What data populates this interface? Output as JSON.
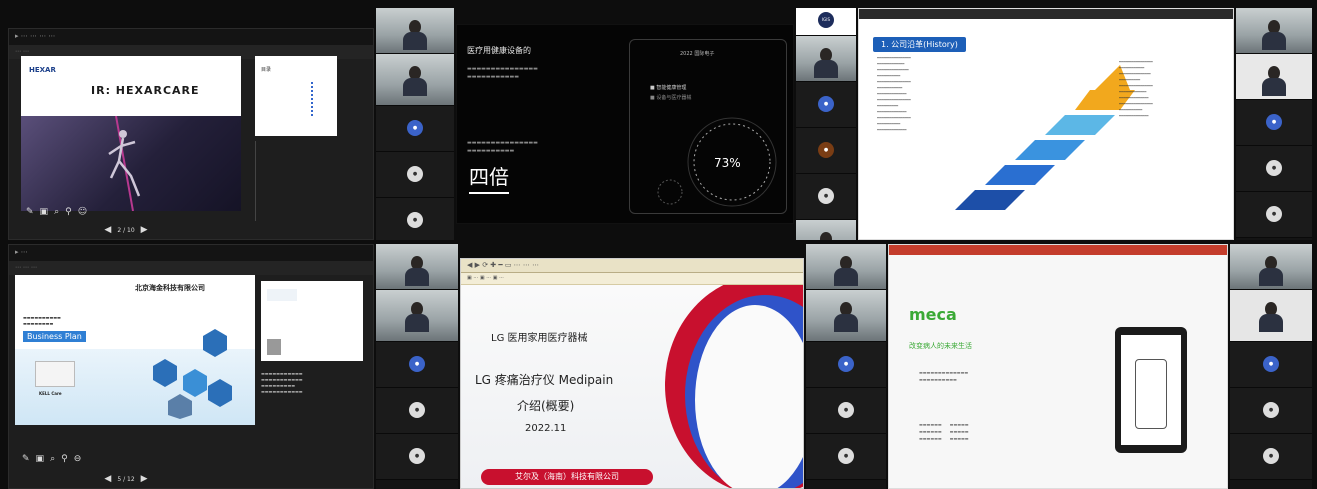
{
  "windows": {
    "hexar": {
      "title": "IR: HEXARCARE",
      "logo": "HEXAR",
      "thumb_title": "目录",
      "page_counter": "2 / 10"
    },
    "dark_slide": {
      "heading": "医疗用健康设备的",
      "big_text": "四倍",
      "percent": "73%",
      "right_title": "2022 国际电子",
      "legend_a": "智能健康管理",
      "legend_b": "设备与医疗器械"
    },
    "history": {
      "title": "1. 公司沿革(History)",
      "brand": "IGIS"
    },
    "beijing": {
      "company": "北京海金科技有限公司",
      "business_plan": "Business Plan",
      "product_name": "KELL Care",
      "page_counter": "5 / 12"
    },
    "lg": {
      "line1": "LG 医用家用医疗器械",
      "line2": "LG 疼痛治疗仪 Medipain",
      "line3": "介绍(概要)",
      "date": "2022.11",
      "footer_company": "艾尔及（海南）科技有限公司"
    },
    "meca": {
      "logo": "meca",
      "slogan": "改变病人的未来生活"
    }
  },
  "colors": {
    "history_blue": "#1d5fb8",
    "lg_red": "#c8102e",
    "avatar_blue": "#3b63c9",
    "meca_green": "#3aa935"
  }
}
